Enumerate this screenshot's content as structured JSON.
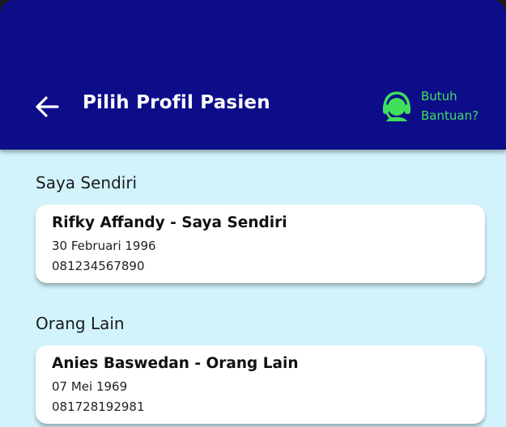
{
  "header": {
    "title": "Pilih Profil Pasien",
    "back_icon": "arrow-left-icon",
    "help": {
      "icon": "support-agent-icon",
      "line1": "Butuh",
      "line2": "Bantuan?"
    }
  },
  "sections": [
    {
      "label": "Saya Sendiri",
      "profiles": [
        {
          "name": "Rifky Affandy - Saya Sendiri",
          "dob": "30 Februari 1996",
          "phone": "081234567890"
        }
      ]
    },
    {
      "label": "Orang Lain",
      "profiles": [
        {
          "name": "Anies Baswedan - Orang Lain",
          "dob": "07 Mei 1969",
          "phone": "081728192981"
        }
      ]
    }
  ],
  "colors": {
    "appbar": "#0d0d8a",
    "background": "#d2f3fc",
    "help_accent": "#3ee05a",
    "card": "#ffffff"
  }
}
